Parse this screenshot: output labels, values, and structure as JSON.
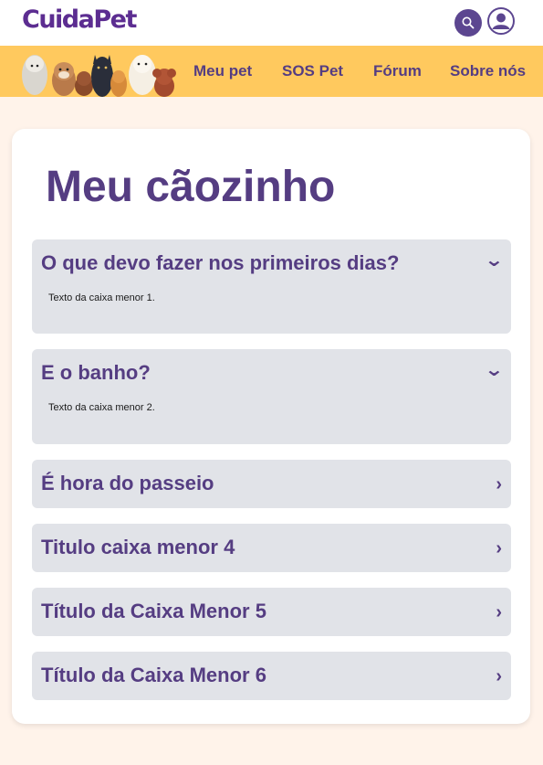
{
  "brand": {
    "logo": "CuidaPet"
  },
  "header": {
    "search_icon": "search-icon",
    "user_icon": "user-icon"
  },
  "nav": {
    "items": [
      {
        "label": "Meu pet"
      },
      {
        "label": "SOS Pet"
      },
      {
        "label": "Fórum"
      },
      {
        "label": "Sobre nós"
      }
    ]
  },
  "main": {
    "title": "Meu cãozinho",
    "accordion": [
      {
        "title": "O que devo fazer nos primeiros dias?",
        "body": "Texto da caixa menor 1.",
        "expanded": true,
        "chevron": "⌄"
      },
      {
        "title": "E o banho?",
        "body": "Texto da caixa menor 2.",
        "expanded": true,
        "chevron": "⌄"
      },
      {
        "title": "É hora do passeio",
        "expanded": false,
        "chevron": "›"
      },
      {
        "title": "Titulo caixa menor 4",
        "expanded": false,
        "chevron": "›"
      },
      {
        "title": "Título da Caixa Menor 5",
        "expanded": false,
        "chevron": "›"
      },
      {
        "title": "Título da Caixa Menor 6",
        "expanded": false,
        "chevron": "›"
      }
    ]
  },
  "colors": {
    "brand_purple": "#553d82",
    "nav_yellow": "#ffc95e",
    "page_bg": "#fff3ea",
    "accordion_bg": "#e1e3e8"
  }
}
